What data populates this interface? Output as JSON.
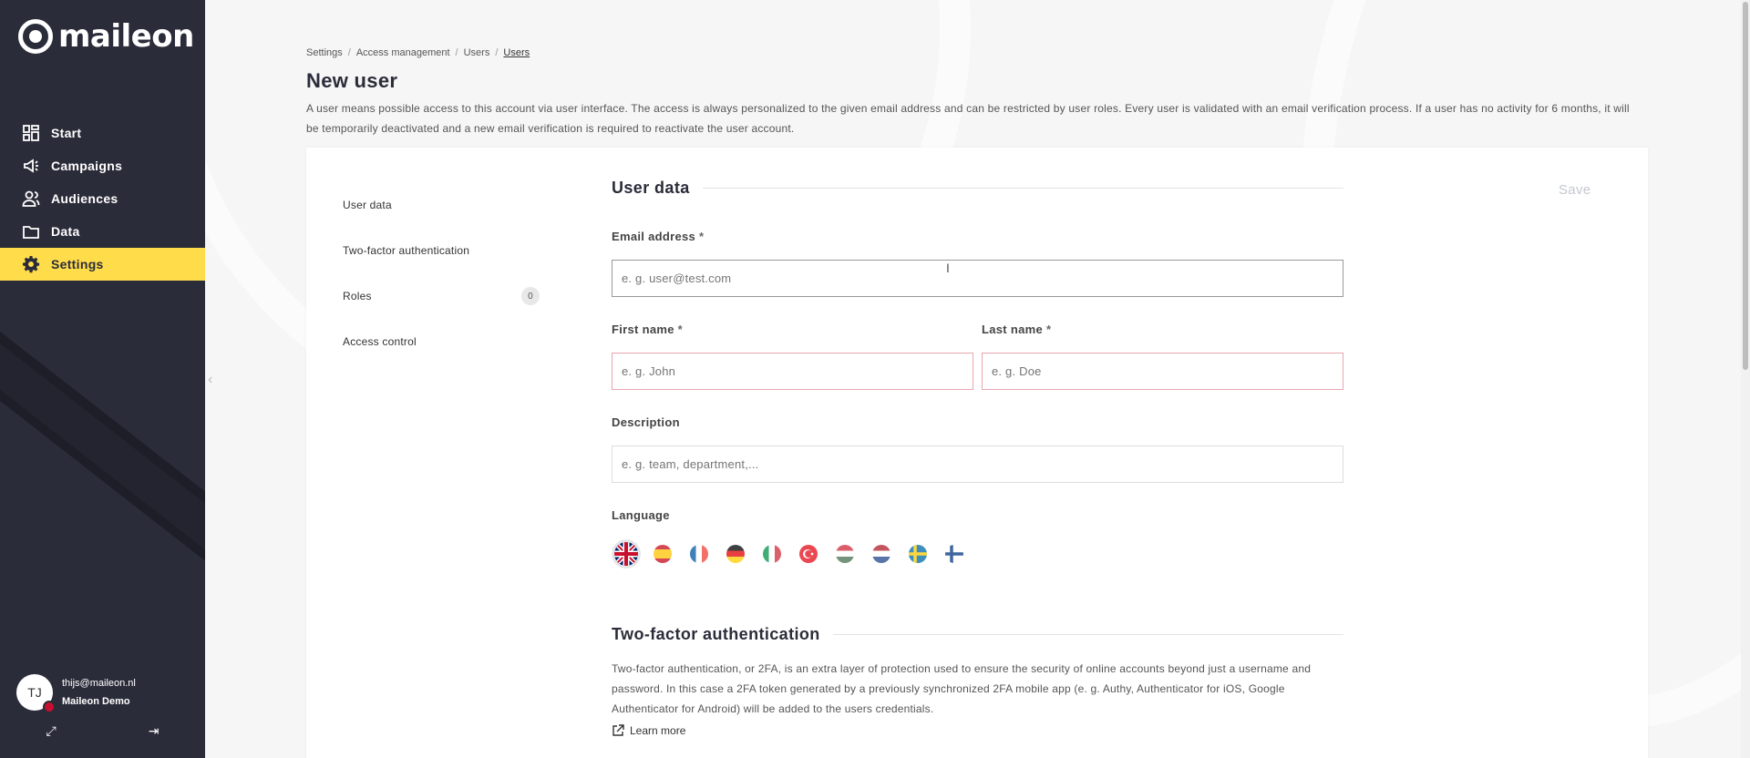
{
  "app": {
    "logo_text": "maileon"
  },
  "sidebar": {
    "items": [
      {
        "label": "Start",
        "icon": "dashboard-icon",
        "active": false
      },
      {
        "label": "Campaigns",
        "icon": "megaphone-icon",
        "active": false
      },
      {
        "label": "Audiences",
        "icon": "people-icon",
        "active": false
      },
      {
        "label": "Data",
        "icon": "folder-icon",
        "active": false
      },
      {
        "label": "Settings",
        "icon": "gear-icon",
        "active": true
      }
    ],
    "user": {
      "initials": "TJ",
      "email": "thijs@maileon.nl",
      "account": "Maileon Demo"
    }
  },
  "breadcrumb": [
    "Settings",
    "Access management",
    "Users",
    "Users"
  ],
  "page": {
    "title": "New user",
    "intro": "A user means possible access to this account via user interface. The access is always personalized to the given email address and can be restricted by user roles. Every user is validated with an email verification process. If a user has no activity for 6 months, it will be temporarily deactivated and a new email verification is required to reactivate the user account."
  },
  "subnav": [
    {
      "label": "User data"
    },
    {
      "label": "Two-factor authentication"
    },
    {
      "label": "Roles",
      "count": "0"
    },
    {
      "label": "Access control"
    }
  ],
  "form": {
    "section_title": "User data",
    "save_label": "Save",
    "email": {
      "label": "Email address",
      "required": "*",
      "placeholder": "e. g. user@test.com"
    },
    "first_name": {
      "label": "First name",
      "required": "*",
      "placeholder": "e. g. John"
    },
    "last_name": {
      "label": "Last name",
      "required": "*",
      "placeholder": "e. g. Doe"
    },
    "description": {
      "label": "Description",
      "placeholder": "e. g. team, department,..."
    },
    "language": {
      "label": "Language",
      "options": [
        "en",
        "es",
        "fr",
        "de",
        "it",
        "tr",
        "hu",
        "nl",
        "sv",
        "fi"
      ],
      "selected": "en"
    }
  },
  "tfa": {
    "title": "Two-factor authentication",
    "text": "Two-factor authentication, or 2FA, is an extra layer of protection used to ensure the security of online accounts beyond just a username and password. In this case a 2FA token generated by a previously synchronized 2FA mobile app (e. g. Authy, Authenticator for iOS, Google Authenticator for Android) will be added to the users credentials.",
    "learn_more": "Learn more"
  },
  "colors": {
    "sidebar_bg": "#2b2c3a",
    "accent": "#fedc4a",
    "error_border": "#e8a6ad"
  }
}
